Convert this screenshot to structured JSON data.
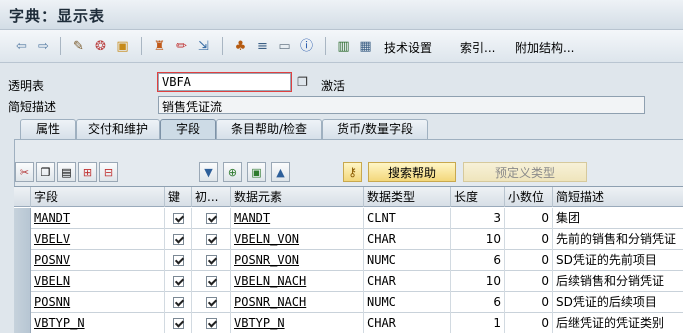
{
  "window": {
    "title": "字典：显示表"
  },
  "toolbar": {
    "icons": [
      "back-arrow-icon",
      "forward-arrow-icon",
      "glasses-pencil-icon",
      "object-list-icon",
      "transport-icon",
      "hierarchy-icon",
      "pencil-icon",
      "where-used-icon",
      "tree-icon",
      "stack-icon",
      "window-icon",
      "info-icon",
      "columns-icon",
      "grid-icon"
    ],
    "tech_settings": "技术设置",
    "index": "索引...",
    "append_structure": "附加结构..."
  },
  "form": {
    "table_label": "透明表",
    "table_value": "VBFA",
    "status": "激活",
    "desc_label": "简短描述",
    "desc_value": "销售凭证流"
  },
  "tabs": [
    {
      "label": "属性",
      "selected": false
    },
    {
      "label": "交付和维护",
      "selected": false
    },
    {
      "label": "字段",
      "selected": true
    },
    {
      "label": "条目帮助/检查",
      "selected": false
    },
    {
      "label": "货币/数量字段",
      "selected": false
    }
  ],
  "panel": {
    "search_help": "搜索帮助",
    "predefined_type": "预定义类型"
  },
  "table": {
    "headers": [
      "字段",
      "键",
      "初...",
      "数据元素",
      "数据类型",
      "长度",
      "小数位",
      "简短描述"
    ],
    "rows": [
      {
        "field": "MANDT",
        "key": true,
        "init": true,
        "element": "MANDT",
        "type": "CLNT",
        "length": "3",
        "decimals": "0",
        "desc": "集团"
      },
      {
        "field": "VBELV",
        "key": true,
        "init": true,
        "element": "VBELN_VON",
        "type": "CHAR",
        "length": "10",
        "decimals": "0",
        "desc": "先前的销售和分销凭证"
      },
      {
        "field": "POSNV",
        "key": true,
        "init": true,
        "element": "POSNR_VON",
        "type": "NUMC",
        "length": "6",
        "decimals": "0",
        "desc": "SD凭证的先前项目"
      },
      {
        "field": "VBELN",
        "key": true,
        "init": true,
        "element": "VBELN_NACH",
        "type": "CHAR",
        "length": "10",
        "decimals": "0",
        "desc": "后续销售和分销凭证"
      },
      {
        "field": "POSNN",
        "key": true,
        "init": true,
        "element": "POSNR_NACH",
        "type": "NUMC",
        "length": "6",
        "decimals": "0",
        "desc": "SD凭证的后续项目"
      },
      {
        "field": "VBTYP_N",
        "key": true,
        "init": true,
        "element": "VBTYP_N",
        "type": "CHAR",
        "length": "1",
        "decimals": "0",
        "desc": "后继凭证的凭证类别"
      }
    ]
  }
}
